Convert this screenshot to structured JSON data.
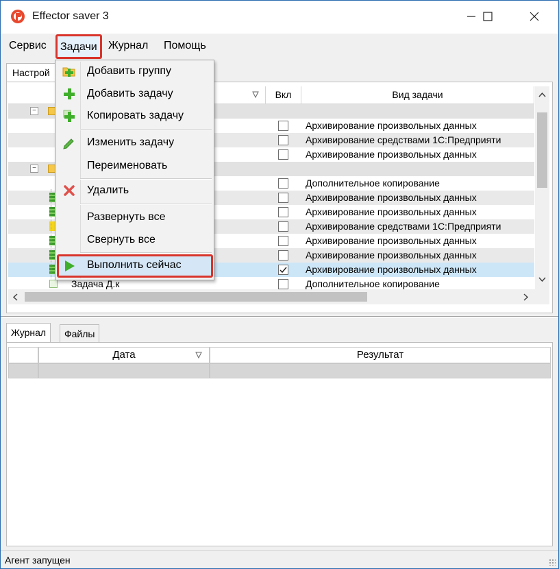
{
  "window": {
    "title": "Effector saver 3",
    "accent": "#d9342b"
  },
  "menubar": {
    "items": [
      "Сервис",
      "Задачи",
      "Журнал",
      "Помощь"
    ]
  },
  "top_tab": {
    "label": "Настрой"
  },
  "grid": {
    "columns": {
      "vkl": "Вкл",
      "kind": "Вид задачи"
    },
    "rows": [
      {
        "kind": "",
        "checked": false,
        "group": true
      },
      {
        "kind": "Архивирование произвольных данных",
        "checked": false
      },
      {
        "kind": "Архивирование средствами 1С:Предприяти",
        "checked": false
      },
      {
        "kind": "Архивирование произвольных данных",
        "checked": false
      },
      {
        "kind": "",
        "checked": false,
        "group": true
      },
      {
        "kind": "Дополнительное копирование",
        "checked": false
      },
      {
        "kind": "Архивирование произвольных данных",
        "checked": false
      },
      {
        "kind": "Архивирование произвольных данных",
        "checked": false
      },
      {
        "kind": "Архивирование средствами 1С:Предприяти",
        "checked": false
      },
      {
        "kind": "Архивирование произвольных данных",
        "checked": false
      },
      {
        "kind": "Архивирование произвольных данных",
        "checked": false
      },
      {
        "kind": "Архивирование произвольных данных",
        "checked": true,
        "selected": true
      },
      {
        "kind": "Дополнительное копирование",
        "checked": false
      }
    ],
    "partial_task_name": "Задача Д.к"
  },
  "dropdown": {
    "items": [
      {
        "label": "Добавить группу",
        "icon": "folder-add-icon"
      },
      {
        "label": "Добавить задачу",
        "icon": "plus-icon"
      },
      {
        "label": "Копировать задачу",
        "icon": "copy-plus-icon"
      },
      {
        "label": "Изменить  задачу",
        "icon": "pencil-icon"
      },
      {
        "label": "Переименовать",
        "icon": ""
      },
      {
        "label": "Удалить",
        "icon": "close-icon"
      },
      {
        "label": "Развернуть все",
        "icon": ""
      },
      {
        "label": "Свернуть все",
        "icon": ""
      },
      {
        "label": "Выполнить сейчас",
        "icon": "play-icon"
      }
    ]
  },
  "bottom_tabs": [
    "Журнал",
    "Файлы"
  ],
  "log_grid": {
    "columns": {
      "date": "Дата",
      "result": "Результат"
    }
  },
  "status": {
    "text": "Агент запущен"
  }
}
